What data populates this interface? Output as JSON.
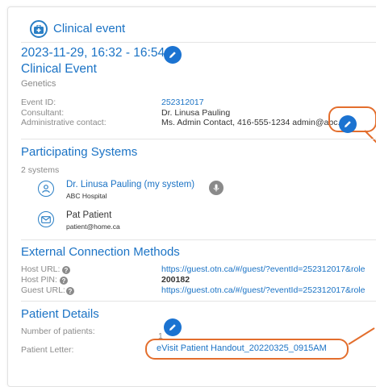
{
  "header": {
    "title": "Clinical event"
  },
  "event": {
    "datetime": "2023-11-29, 16:32 - 16:54",
    "title": "Clinical Event",
    "subtitle": "Genetics",
    "fields": [
      {
        "label": "Event ID:",
        "value": "252312017"
      },
      {
        "label": "Consultant:",
        "value": "Dr. Linusa Pauling"
      },
      {
        "label": "Administrative contact:",
        "value": "Ms. Admin Contact, 416-555-1234 admin@abc.org"
      }
    ]
  },
  "participating": {
    "title": "Participating Systems",
    "count": "2 systems",
    "systems": [
      {
        "name": "Dr. Linusa Pauling (my system)",
        "detail": "ABC Hospital"
      },
      {
        "name": "Pat Patient",
        "detail": "patient@home.ca"
      }
    ]
  },
  "connection": {
    "title": "External Connection Methods",
    "fields": [
      {
        "label": "Host URL:",
        "value": "https://guest.otn.ca/#/guest/?eventId=252312017&role"
      },
      {
        "label": "Host PIN:",
        "value": "200182"
      },
      {
        "label": "Guest URL:",
        "value": "https://guest.otn.ca/#/guest/?eventId=252312017&role"
      }
    ]
  },
  "patient": {
    "title": "Patient Details",
    "number_label": "Number of patients:",
    "number_value": "1",
    "letter_label": "Patient Letter:",
    "letter_value": "eVisit Patient Handout_20220325_0915AM"
  },
  "colors": {
    "accent": "#1b73c5",
    "callout": "#e36e2d",
    "pencil_bg": "#1b73d1"
  }
}
